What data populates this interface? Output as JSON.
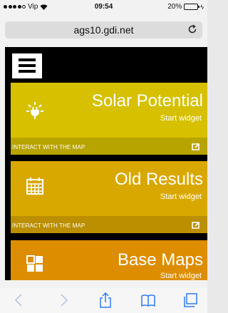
{
  "status_bar": {
    "carrier": "Vip",
    "time": "09:54",
    "battery": "20%",
    "battery_level": 0.2,
    "battery_color": "#e0202c"
  },
  "address_bar": {
    "url": "ags10.gdi.net",
    "reload_icon": "reload-icon"
  },
  "app": {
    "menu_icon": "hamburger-menu-icon",
    "cards": [
      {
        "title": "Solar Potential",
        "subtitle": "Start widget",
        "footer": "INTERACT WITH THE MAP",
        "icon": "sun-plug-icon",
        "top_color": "#d6c000",
        "bottom_color": "#b8a400"
      },
      {
        "title": "Old Results",
        "subtitle": "Start widget",
        "footer": "INTERACT WITH THE MAP",
        "icon": "calendar-grid-icon",
        "top_color": "#d9a800",
        "bottom_color": "#bb8f00"
      },
      {
        "title": "Base Maps",
        "subtitle": "Start widget",
        "icon": "layers-grid-icon",
        "top_color": "#dd8d00",
        "bottom_color": "#bd7700"
      }
    ]
  },
  "toolbar": {
    "back_icon": "back-arrow-icon",
    "forward_icon": "forward-arrow-icon",
    "share_icon": "share-icon",
    "bookmarks_icon": "bookmarks-book-icon",
    "tabs_icon": "tabs-icon"
  }
}
